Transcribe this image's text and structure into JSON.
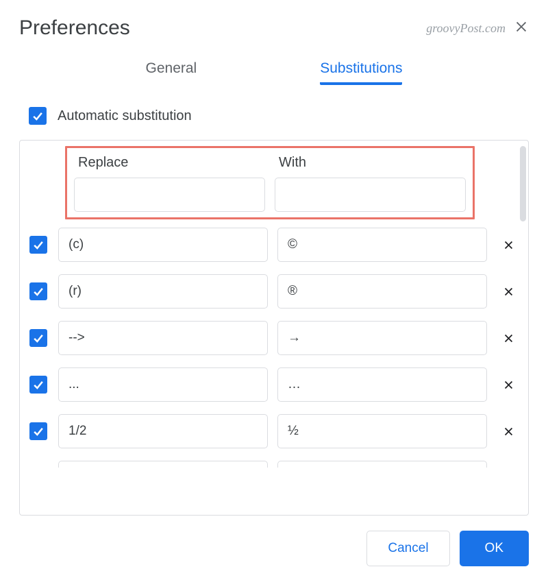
{
  "dialog": {
    "title": "Preferences",
    "watermark": "groovyPost.com"
  },
  "tabs": {
    "general": "General",
    "substitutions": "Substitutions"
  },
  "autoSub": {
    "label": "Automatic substitution",
    "checked": true
  },
  "columns": {
    "replace": "Replace",
    "with": "With"
  },
  "newRow": {
    "replace": "",
    "with": ""
  },
  "rows": [
    {
      "checked": true,
      "replace": "(c)",
      "with": "©"
    },
    {
      "checked": true,
      "replace": "(r)",
      "with": "®"
    },
    {
      "checked": true,
      "replace": "-->",
      "with": "→"
    },
    {
      "checked": true,
      "replace": "...",
      "with": "…"
    },
    {
      "checked": true,
      "replace": "1/2",
      "with": "½"
    }
  ],
  "buttons": {
    "cancel": "Cancel",
    "ok": "OK"
  }
}
